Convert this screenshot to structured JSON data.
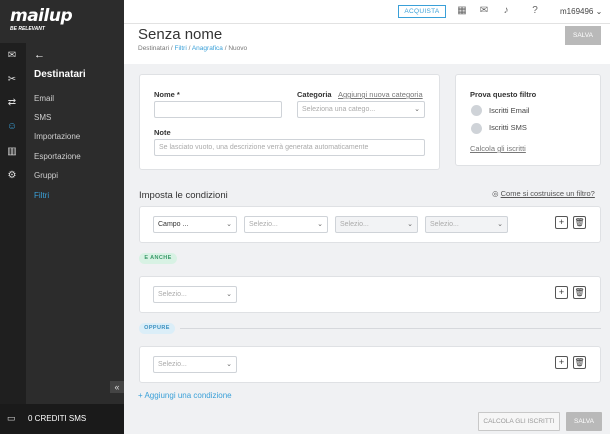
{
  "brand": {
    "name": "mailup",
    "tagline": "BE RELEVANT"
  },
  "rail_icons": [
    "envelope-icon",
    "tools-icon",
    "shuffle-icon",
    "user-icon",
    "bar-chart-icon",
    "gear-icon"
  ],
  "subnav": {
    "title": "Destinatari",
    "items": [
      {
        "label": "Email"
      },
      {
        "label": "SMS"
      },
      {
        "label": "Importazione"
      },
      {
        "label": "Esportazione"
      },
      {
        "label": "Gruppi"
      },
      {
        "label": "Filtri",
        "active": true
      }
    ]
  },
  "footer": {
    "credits": "0 CREDITI SMS"
  },
  "topbar": {
    "buy_label": "ACQUISTA",
    "user": "m169496",
    "user_caret": "⌄"
  },
  "header": {
    "title": "Senza nome",
    "breadcrumb": [
      "Destinatari",
      "Filtri",
      "Anagrafica",
      "Nuovo"
    ],
    "sep": " / ",
    "save_label": "SALVA"
  },
  "form": {
    "name_label": "Nome *",
    "name_value": "",
    "category_label": "Categoria",
    "add_category_link": "Aggiungi nuova categoria",
    "category_placeholder": "Seleziona una catego...",
    "notes_label": "Note",
    "notes_placeholder": "Se lasciato vuoto, una descrizione verrà generata automaticamente"
  },
  "try_filter": {
    "title": "Prova questo filtro",
    "options": [
      "Iscritti Email",
      "Iscritti SMS"
    ],
    "calc_link": "Calcola gli iscritti"
  },
  "conditions": {
    "title": "Imposta le condizioni",
    "help_link": "Come si costruisce un filtro?",
    "row1": {
      "field": "Campo ...",
      "sel1": "Selezio...",
      "sel2": "Selezio...",
      "sel3": "Selezio..."
    },
    "and_label": "E ANCHE",
    "row2": {
      "sel": "Selezio..."
    },
    "or_label": "OPPURE",
    "row3": {
      "sel": "Selezio..."
    },
    "add_label": "Aggiungi una condizione",
    "add_icon": "+",
    "plus": "+",
    "trash": "🗑"
  },
  "bottom": {
    "calc_label": "CALCOLA GLI ISCRITTI",
    "save_label": "SALVA"
  }
}
